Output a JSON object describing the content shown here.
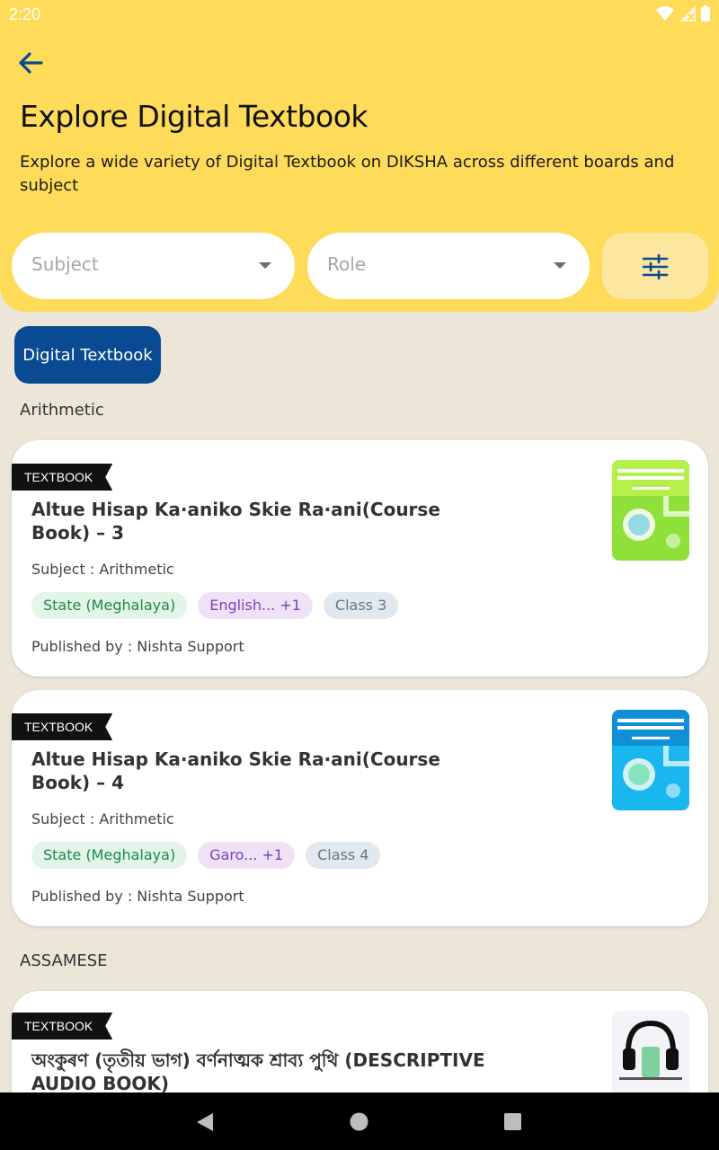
{
  "status_bar": {
    "time": "2:20"
  },
  "header": {
    "title": "Explore Digital Textbook",
    "subtitle": "Explore a wide variety of Digital Textbook on DIKSHA across different boards and subject",
    "subject_placeholder": "Subject",
    "role_placeholder": "Role"
  },
  "filter_chip": {
    "label": "Digital Textbook"
  },
  "sections": [
    {
      "title": "Arithmetic"
    },
    {
      "title": "ASSAMESE"
    }
  ],
  "cards": [
    {
      "tag": "TEXTBOOK",
      "title": "Altue Hisap Ka·aniko Skie Ra·ani(Course Book) – 3",
      "subject": "Subject : Arithmetic",
      "board": "State (Meghalaya)",
      "medium": "English... +1",
      "grade": "Class 3",
      "publisher": "Published by : Nishta Support",
      "thumb_color": "#8fe03a"
    },
    {
      "tag": "TEXTBOOK",
      "title": "Altue Hisap Ka·aniko Skie Ra·ani(Course Book) – 4",
      "subject": "Subject : Arithmetic",
      "board": "State (Meghalaya)",
      "medium": "Garo... +1",
      "grade": "Class 4",
      "publisher": "Published by : Nishta Support",
      "thumb_color": "#1ab7ee"
    },
    {
      "tag": "TEXTBOOK",
      "title": "অংকুৰণ (তৃতীয় ভাগ) বৰ্ণনাত্মক শ্ৰাব্য পুথি (DESCRIPTIVE AUDIO BOOK)"
    }
  ],
  "colors": {
    "header_bg": "#ffdb5a",
    "page_bg": "#ebe6d8",
    "chip_bg": "#0a4a92",
    "accent": "#0a4a92"
  }
}
